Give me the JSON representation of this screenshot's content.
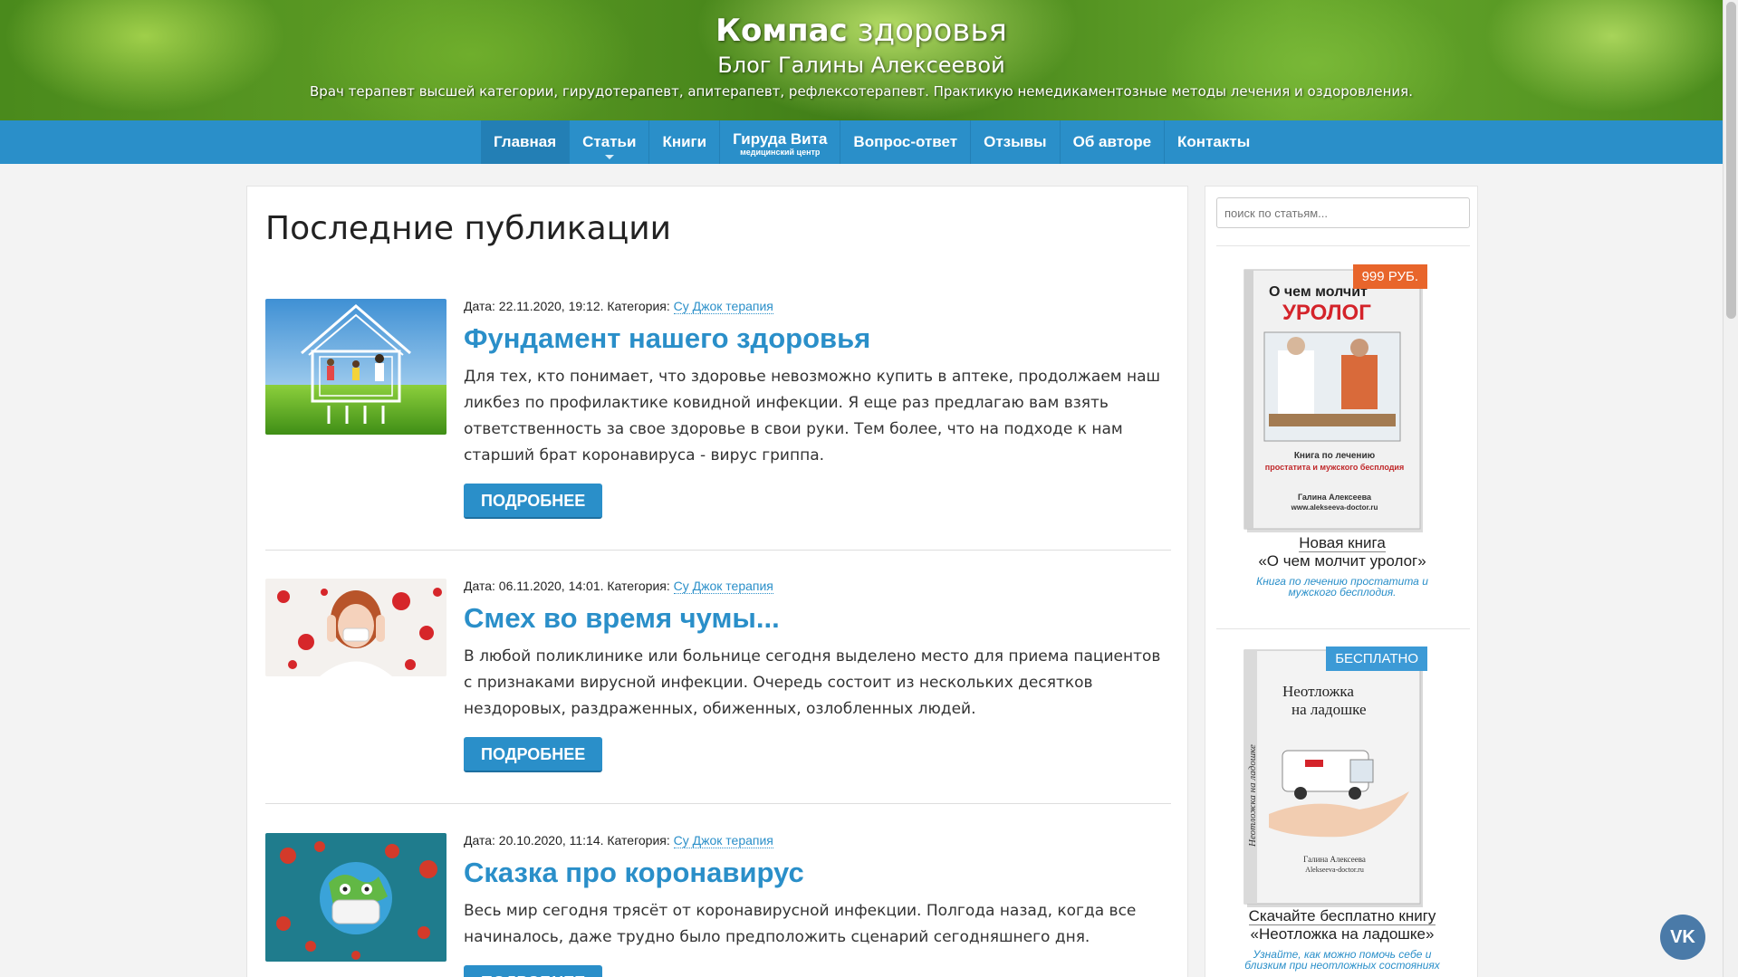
{
  "header": {
    "title_bold": "Компас",
    "title_rest": " здоровья",
    "subtitle": "Блог Галины Алексеевой",
    "description": "Врач терапевт высшей категории, гирудотерапевт, апитерапевт, рефлексотерапевт. Практикую немедикаментозные методы лечения и оздоровления."
  },
  "nav": {
    "items": [
      {
        "label": "Главная"
      },
      {
        "label": "Статьи"
      },
      {
        "label": "Книги"
      },
      {
        "label": "Гируда Вита",
        "sub": "медицинский центр"
      },
      {
        "label": "Вопрос-ответ"
      },
      {
        "label": "Отзывы"
      },
      {
        "label": "Об авторе"
      },
      {
        "label": "Контакты"
      }
    ]
  },
  "main": {
    "heading": "Последние публикации",
    "posts": [
      {
        "meta_prefix": "Дата: 22.11.2020, 19:12. Категория: ",
        "category": "Су Джок терапия",
        "title": "Фундамент нашего здоровья",
        "excerpt": "Для тех, кто понимает, что здоровье невозможно купить в аптеке, продолжаем наш ликбез по профилактике ковидной инфекции. Я еще раз предлагаю вам взять ответственность за свое здоровье в свои руки. Тем более, что на подходе к нам старший брат коронавируса - вирус гриппа.",
        "button": "ПОДРОБНЕЕ"
      },
      {
        "meta_prefix": "Дата: 06.11.2020, 14:01. Категория: ",
        "category": "Су Джок терапия",
        "title": "Смех во время чумы...",
        "excerpt": "В любой поликлинике или больнице сегодня выделено место для приема пациентов с признаками вирусной инфекции. Очередь состоит из нескольких десятков нездоровых, раздраженных, обиженных, озлобленных людей.",
        "button": "ПОДРОБНЕЕ"
      },
      {
        "meta_prefix": "Дата: 20.10.2020, 11:14. Категория: ",
        "category": "Су Джок терапия",
        "title": "Сказка про коронавирус",
        "excerpt": "Весь мир сегодня трясёт от коронавирусной инфекции. Полгода назад, когда все начиналось, даже трудно было предположить сценарий сегодняшнего дня.",
        "button": "ПОДРОБНЕЕ"
      }
    ]
  },
  "sidebar": {
    "search_placeholder": "поиск по статьям...",
    "books": [
      {
        "badge": "999 РУБ.",
        "badge_color": "#e8652b",
        "cover_line1": "О чем молчит",
        "cover_line2": "УРОЛОГ",
        "cover_small1": "Книга по лечению",
        "cover_small2": "простатита и мужского бесплодия",
        "cover_author": "Галина Алексеева",
        "cover_site": "www.alekseeva-doctor.ru",
        "caption1": "Новая книга",
        "caption2": "«О чем молчит уролог»",
        "note": "Книга по лечению простатита и мужского бесплодия."
      },
      {
        "badge": "БЕСПЛАТНО",
        "badge_color": "#3c9ad6",
        "cover_line1": "Неотложка",
        "cover_line2": "на ладошке",
        "cover_spine": "Неотложка на ладошке",
        "cover_author": "Галина Алексеева",
        "cover_site": "Alekseeva-doctor.ru",
        "caption1": "Скачайте бесплатно книгу",
        "caption2": "«Неотложка на ладошке»",
        "note": "Узнайте, как можно помочь себе и близким при неотложных состояниях"
      }
    ]
  },
  "vk_label": "VK"
}
